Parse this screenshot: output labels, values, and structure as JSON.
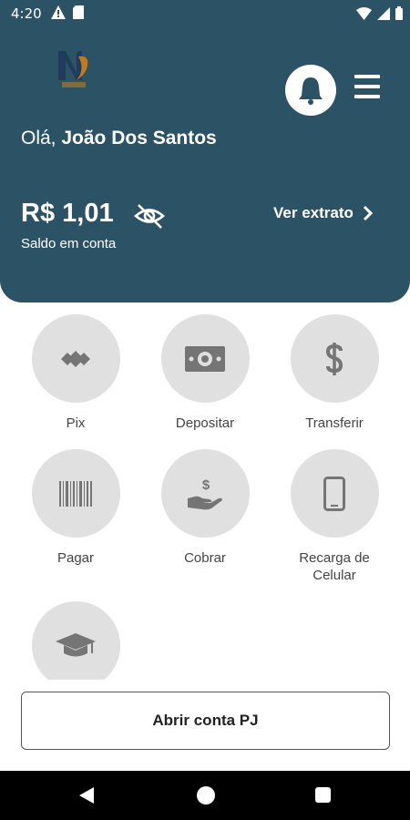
{
  "status_bar": {
    "time": "4:20",
    "left_icons": [
      "warning-icon",
      "sd-card-icon"
    ],
    "right_icons": [
      "wifi-icon",
      "signal-icon",
      "battery-icon"
    ]
  },
  "header": {
    "background": "#2c5266",
    "greeting_prefix": "Olá, ",
    "user_name": "João Dos Santos",
    "balance": "R$ 1,01",
    "balance_label": "Saldo em conta",
    "statement_link": "Ver extrato",
    "icons": [
      "logo",
      "bell-icon",
      "menu-icon",
      "eye-off-icon",
      "chevron-right-icon"
    ]
  },
  "actions": [
    {
      "label": "Pix",
      "icon": "pix-icon"
    },
    {
      "label": "Depositar",
      "icon": "money-icon"
    },
    {
      "label": "Transferir",
      "icon": "dollar-icon"
    },
    {
      "label": "Pagar",
      "icon": "barcode-icon"
    },
    {
      "label": "Cobrar",
      "icon": "hand-dollar-icon"
    },
    {
      "label": "Recarga de Celular",
      "icon": "phone-icon"
    },
    {
      "label": "",
      "icon": "graduation-cap-icon"
    }
  ],
  "bottom": {
    "open_pj_account": "Abrir conta PJ"
  },
  "colors": {
    "accent": "#2c5266",
    "action_circle": "#e0e0e0",
    "icon_gray": "#757575"
  }
}
